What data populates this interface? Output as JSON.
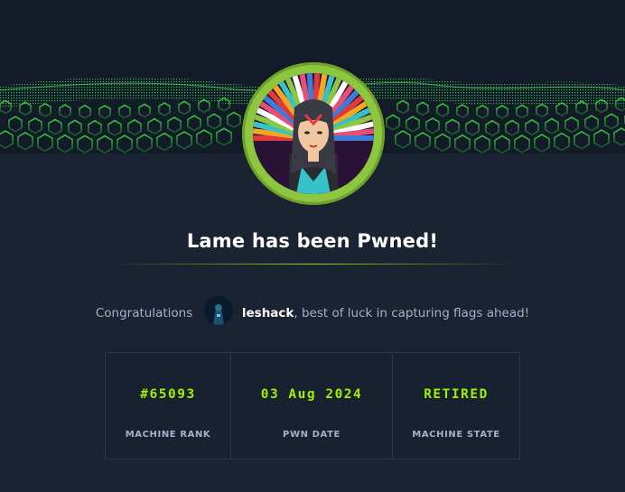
{
  "page": {
    "title": "Lame has been Pwned!",
    "accent_color": "#9fef00"
  },
  "banner": {
    "pattern": "green-hexagon-cubes-wave",
    "machine_avatar": "aztec-woman-avatar"
  },
  "congrats": {
    "prefix": "Congratulations",
    "user_avatar": "user-avatar-icon",
    "username": "leshack",
    "suffix": ", best of luck in capturing flags ahead!"
  },
  "stats": [
    {
      "value": "#65093",
      "label": "MACHINE RANK"
    },
    {
      "value": "03 Aug 2024",
      "label": "PWN DATE"
    },
    {
      "value": "RETIRED",
      "label": "MACHINE STATE"
    }
  ]
}
